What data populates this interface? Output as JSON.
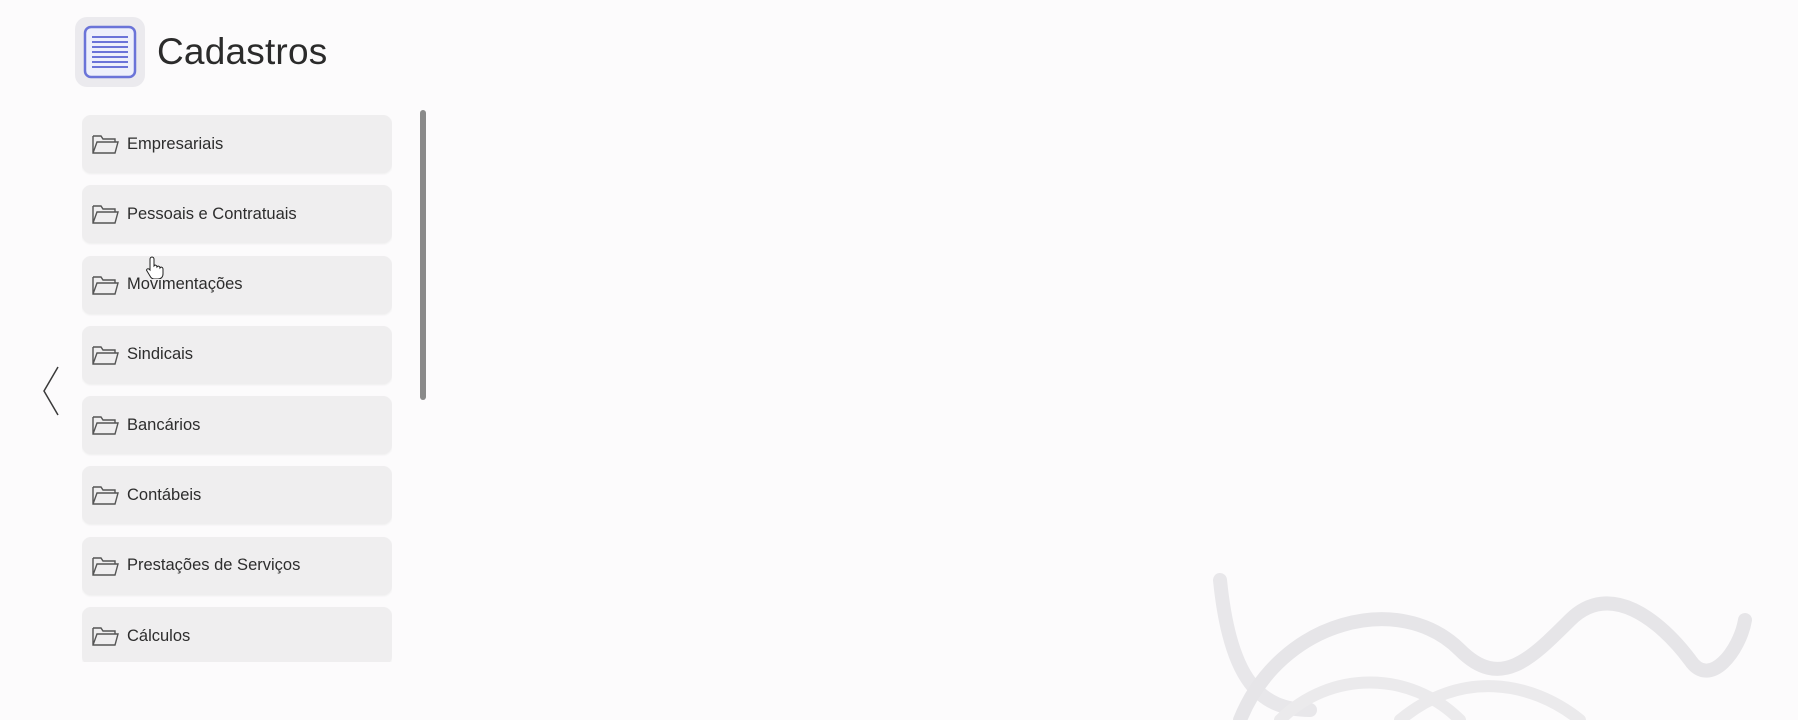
{
  "header": {
    "title": "Cadastros",
    "icon": "document-list-icon"
  },
  "navigation": {
    "back_icon": "chevron-left-icon"
  },
  "menu": {
    "item_icon": "folder-icon",
    "items": [
      {
        "label": "Empresariais"
      },
      {
        "label": "Pessoais e Contratuais"
      },
      {
        "label": "Movimentações"
      },
      {
        "label": "Sindicais"
      },
      {
        "label": "Bancários"
      },
      {
        "label": "Contábeis"
      },
      {
        "label": "Prestações de Serviços"
      },
      {
        "label": "Cálculos"
      }
    ]
  },
  "colors": {
    "background": "#fcfbfc",
    "item_background": "#efeeef",
    "icon_accent": "#6b74d8",
    "scrollbar": "#8a8a8a"
  }
}
